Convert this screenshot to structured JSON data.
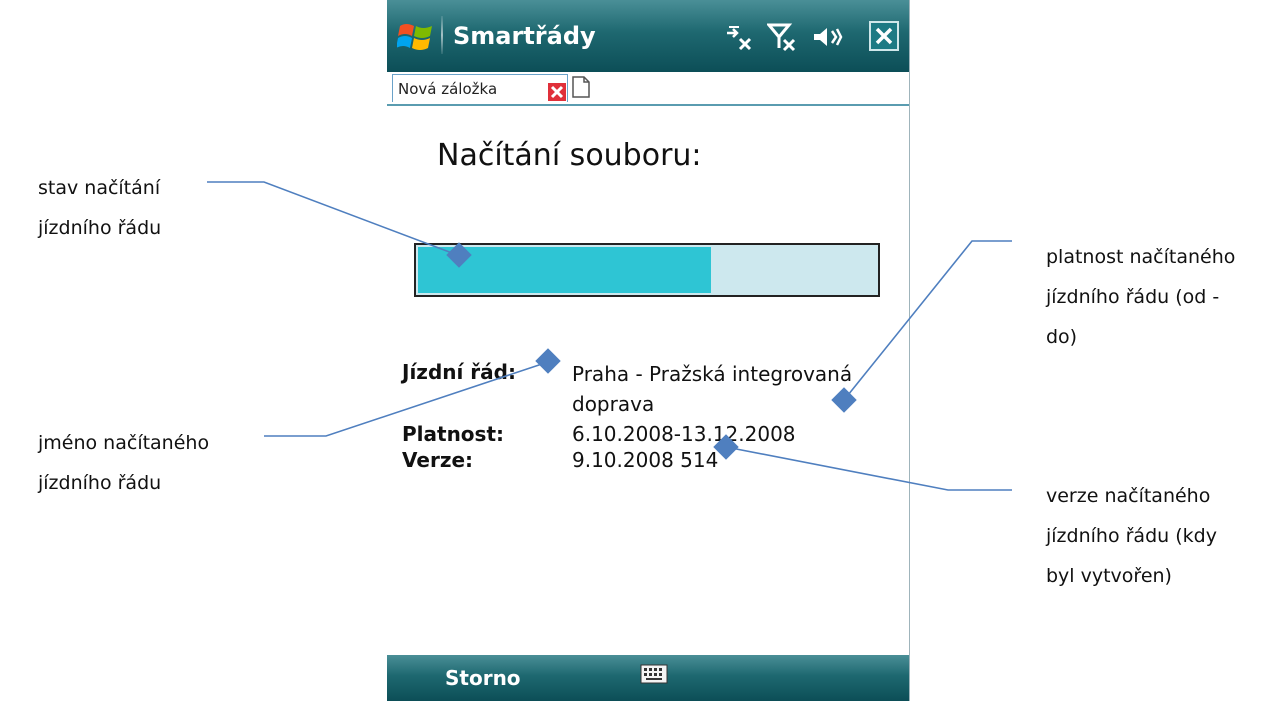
{
  "app": {
    "title": "Smartřády",
    "tab_label": "Nová záložka"
  },
  "status_icons": [
    "connectivity-icon",
    "no-signal-icon",
    "volume-icon"
  ],
  "content": {
    "heading": "Načítání souboru:",
    "progress_fraction": 0.64,
    "rows": [
      {
        "label": "Jízdní řád:",
        "value_line1": "Praha - Pražská integrovaná",
        "value_line2": "doprava"
      },
      {
        "label": "Platnost:",
        "value_line1": "6.10.2008-13.12.2008"
      },
      {
        "label": "Verze:",
        "value_line1": "9.10.2008 514"
      }
    ]
  },
  "softkeys": {
    "left": "Storno"
  },
  "callouts": {
    "progress": [
      "stav načítání",
      "jízdního řádu"
    ],
    "name": [
      "jméno načítaného",
      "jízdního řádu"
    ],
    "validity": [
      "platnost načítaného",
      "jízdního řádu (od -",
      "do)"
    ],
    "version": [
      "verze načítaného",
      "jízdního řádu (kdy",
      "byl vytvořen)"
    ]
  },
  "colors": {
    "titlebar": "#1e6870",
    "progress_fill": "#2ec5d4",
    "progress_track": "#cde8ee",
    "callout_line": "#4f7fbf"
  }
}
